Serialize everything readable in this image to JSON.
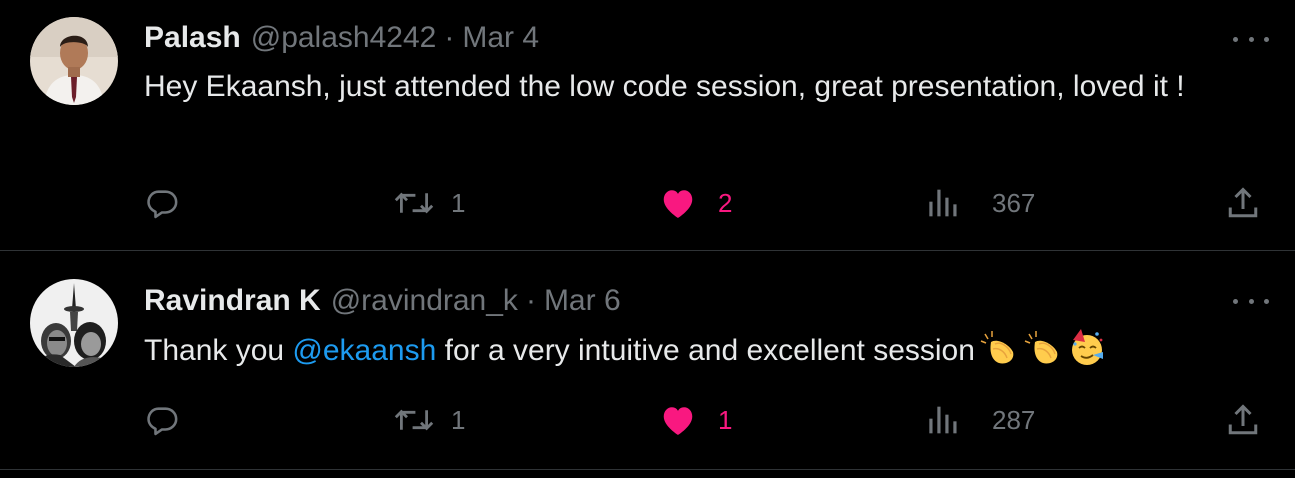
{
  "tweets": [
    {
      "author_name": "Palash",
      "handle": "@palash4242",
      "separator": "·",
      "date": "Mar 4",
      "text": "Hey Ekaansh, just attended the low code session, great presentation, loved it !",
      "retweets": "1",
      "likes": "2",
      "views": "367"
    },
    {
      "author_name": "Ravindran K",
      "handle": "@ravindran_k",
      "separator": "·",
      "date": "Mar 6",
      "text_before": "Thank you ",
      "mention": "@ekaansh",
      "text_after": " for a very intuitive and excellent session",
      "emojis": [
        "clapping-hands",
        "clapping-hands",
        "partying-face"
      ],
      "retweets": "1",
      "likes": "1",
      "views": "287"
    }
  ],
  "colors": {
    "background": "#000000",
    "primary_text": "#e7e9ea",
    "secondary_text": "#71767b",
    "like_pink": "#f91880",
    "mention_blue": "#1d9bf0",
    "divider": "#2f3336"
  },
  "icons": [
    "reply-icon",
    "retweet-icon",
    "heart-icon",
    "views-icon",
    "share-icon",
    "more-icon"
  ]
}
